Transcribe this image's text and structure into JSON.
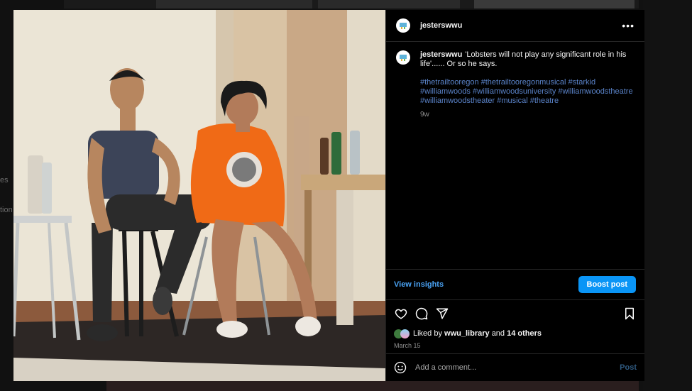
{
  "background": {
    "left_fragment_1": "es",
    "left_fragment_2": "tion"
  },
  "post": {
    "username": "jesterswwu",
    "more_label": "•••",
    "caption_text": "'Lobsters will not play any significant role in his life'...... Or so he says.",
    "hashtags": [
      "#thetrailtooregon",
      "#thetrailtooregonmusical",
      "#starkid",
      "#williamwoods",
      "#williamwoodsuniversity",
      "#williamwoodstheatre",
      "#williamwoodstheater",
      "#musical",
      "#theatre"
    ],
    "age": "9w",
    "view_insights": "View insights",
    "boost_post": "Boost post",
    "likes_prefix": "Liked by",
    "liked_by_user": "wwu_library",
    "likes_and": "and",
    "likes_others": "14 others",
    "date": "March 15",
    "comment_placeholder": "Add a comment...",
    "post_button": "Post"
  },
  "icons": {
    "avatar": "theater-logo-icon",
    "like": "heart-icon",
    "comment": "comment-bubble-icon",
    "share": "paper-plane-icon",
    "save": "bookmark-icon",
    "emoji": "smiley-icon"
  },
  "colors": {
    "link": "#5a83c9",
    "accent_button": "#0a95f6",
    "insights": "#4aa3f5",
    "panel_bg": "#000000"
  }
}
